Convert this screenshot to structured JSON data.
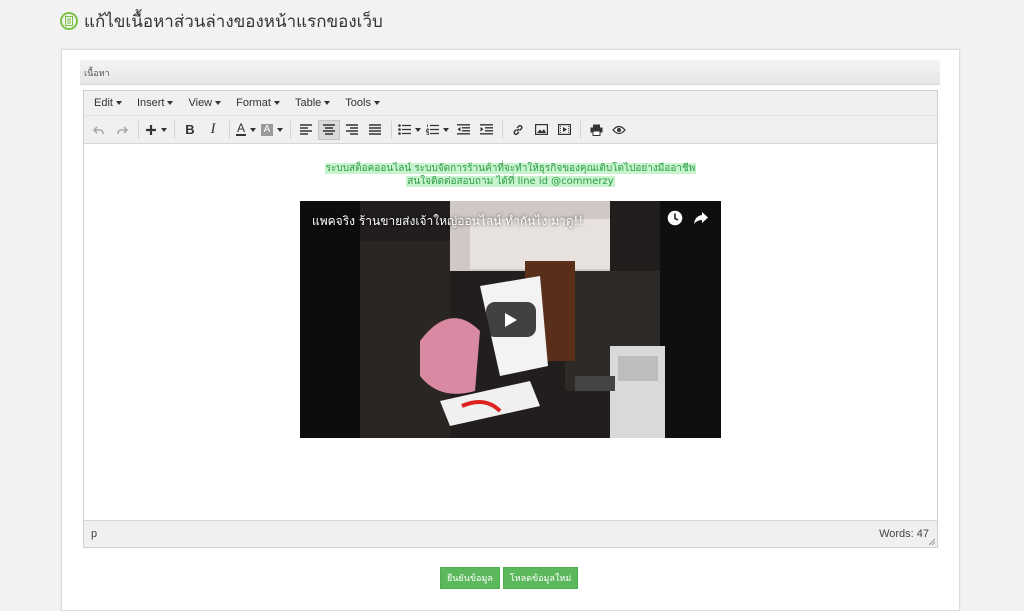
{
  "header": {
    "title": "แก้ไขเนื้อหาส่วนล่างของหน้าแรกของเว็บ",
    "icon": "document-icon",
    "accent_color": "#7cc242"
  },
  "section": {
    "label": "เนื้อหา"
  },
  "editor": {
    "menus": [
      "Edit",
      "Insert",
      "View",
      "Format",
      "Table",
      "Tools"
    ],
    "toolbar_icons": [
      "undo-icon",
      "redo-icon",
      "insert-plus-icon",
      "bold-icon",
      "italic-icon",
      "text-color-icon",
      "background-color-icon",
      "align-left-icon",
      "align-center-icon",
      "align-right-icon",
      "align-justify-icon",
      "bullet-list-icon",
      "numbered-list-icon",
      "outdent-icon",
      "indent-icon",
      "link-icon",
      "image-icon",
      "media-icon",
      "print-icon",
      "preview-icon"
    ],
    "bold_glyph": "B",
    "italic_glyph": "I",
    "text_color_glyph": "A",
    "bg_color_glyph": "A",
    "content": {
      "line1": "ระบบสต็อคออนไลน์ ระบบจัดการร้านค้าที่จะทำให้ธุรกิจของคุณเติบโตไปอย่างมืออาชีพ",
      "line2": "สนใจติดต่อสอบถาม ได้ที่ line id @commerzy",
      "highlight_color": "#c7f3cf",
      "text_color": "#2e9e44"
    },
    "video": {
      "title": "แพคจริง ร้านขายส่งเจ้าใหญ่ออนไลน์ ทำกันไง มาดู!!",
      "icons": [
        "watch-later-icon",
        "share-icon",
        "play-icon"
      ]
    },
    "status": {
      "path": "p",
      "word_count": "Words: 47"
    }
  },
  "actions": {
    "save_label": "ยืนยันข้อมูล",
    "reload_label": "โหลดข้อมูลใหม่",
    "button_color": "#5cb85c"
  }
}
